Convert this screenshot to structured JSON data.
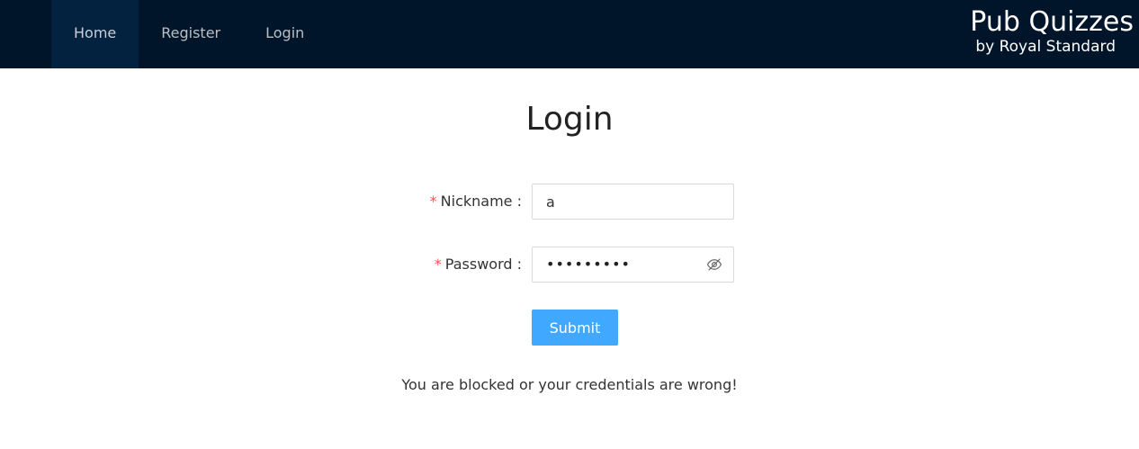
{
  "nav": {
    "items": [
      {
        "label": "Home"
      },
      {
        "label": "Register"
      },
      {
        "label": "Login"
      }
    ]
  },
  "brand": {
    "title": "Pub Quizzes",
    "subtitle": "by Royal Standard"
  },
  "page": {
    "title": "Login"
  },
  "form": {
    "nickname": {
      "label": "Nickname :",
      "value": "a"
    },
    "password": {
      "label": "Password :",
      "masked_value": "•••••••••",
      "visibility_icon": "eye-invisible-icon"
    },
    "required_marker": "*",
    "submit_label": "Submit"
  },
  "message": {
    "error": "You are blocked or your credentials are wrong!"
  },
  "colors": {
    "header_bg": "#001529",
    "active_nav_bg": "#032240",
    "primary": "#40a9ff",
    "required": "#ff4d4f"
  }
}
